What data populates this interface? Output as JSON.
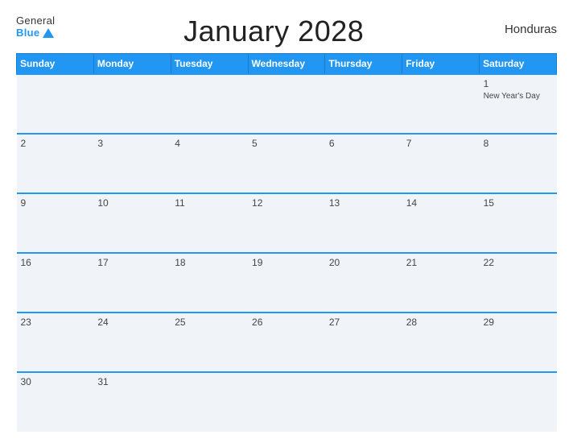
{
  "header": {
    "logo_general": "General",
    "logo_blue": "Blue",
    "title": "January 2028",
    "country": "Honduras"
  },
  "weekdays": [
    "Sunday",
    "Monday",
    "Tuesday",
    "Wednesday",
    "Thursday",
    "Friday",
    "Saturday"
  ],
  "weeks": [
    [
      {
        "day": "",
        "holiday": ""
      },
      {
        "day": "",
        "holiday": ""
      },
      {
        "day": "",
        "holiday": ""
      },
      {
        "day": "",
        "holiday": ""
      },
      {
        "day": "",
        "holiday": ""
      },
      {
        "day": "",
        "holiday": ""
      },
      {
        "day": "1",
        "holiday": "New Year's Day"
      }
    ],
    [
      {
        "day": "2",
        "holiday": ""
      },
      {
        "day": "3",
        "holiday": ""
      },
      {
        "day": "4",
        "holiday": ""
      },
      {
        "day": "5",
        "holiday": ""
      },
      {
        "day": "6",
        "holiday": ""
      },
      {
        "day": "7",
        "holiday": ""
      },
      {
        "day": "8",
        "holiday": ""
      }
    ],
    [
      {
        "day": "9",
        "holiday": ""
      },
      {
        "day": "10",
        "holiday": ""
      },
      {
        "day": "11",
        "holiday": ""
      },
      {
        "day": "12",
        "holiday": ""
      },
      {
        "day": "13",
        "holiday": ""
      },
      {
        "day": "14",
        "holiday": ""
      },
      {
        "day": "15",
        "holiday": ""
      }
    ],
    [
      {
        "day": "16",
        "holiday": ""
      },
      {
        "day": "17",
        "holiday": ""
      },
      {
        "day": "18",
        "holiday": ""
      },
      {
        "day": "19",
        "holiday": ""
      },
      {
        "day": "20",
        "holiday": ""
      },
      {
        "day": "21",
        "holiday": ""
      },
      {
        "day": "22",
        "holiday": ""
      }
    ],
    [
      {
        "day": "23",
        "holiday": ""
      },
      {
        "day": "24",
        "holiday": ""
      },
      {
        "day": "25",
        "holiday": ""
      },
      {
        "day": "26",
        "holiday": ""
      },
      {
        "day": "27",
        "holiday": ""
      },
      {
        "day": "28",
        "holiday": ""
      },
      {
        "day": "29",
        "holiday": ""
      }
    ],
    [
      {
        "day": "30",
        "holiday": ""
      },
      {
        "day": "31",
        "holiday": ""
      },
      {
        "day": "",
        "holiday": ""
      },
      {
        "day": "",
        "holiday": ""
      },
      {
        "day": "",
        "holiday": ""
      },
      {
        "day": "",
        "holiday": ""
      },
      {
        "day": "",
        "holiday": ""
      }
    ]
  ]
}
